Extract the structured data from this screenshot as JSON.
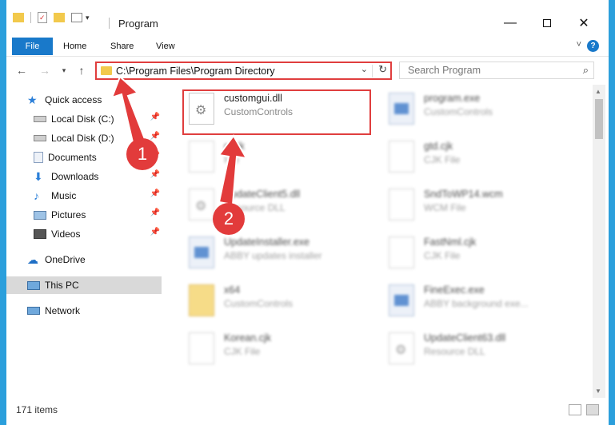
{
  "window": {
    "title": "Program",
    "minimize_icon": "minimize-icon",
    "maximize_icon": "maximize-icon",
    "close_icon": "close-icon"
  },
  "ribbon": {
    "tabs": [
      "File",
      "Home",
      "Share",
      "View"
    ],
    "help": "?"
  },
  "address": {
    "path": "C:\\Program Files\\Program Directory"
  },
  "search": {
    "placeholder": "Search Program"
  },
  "nav": {
    "items": [
      {
        "label": "Quick access",
        "icon": "star-icon"
      },
      {
        "label": "Local Disk (C:)",
        "icon": "drive-icon"
      },
      {
        "label": "Local Disk (D:)",
        "icon": "drive-icon"
      },
      {
        "label": "Documents",
        "icon": "documents-icon"
      },
      {
        "label": "Downloads",
        "icon": "download-icon"
      },
      {
        "label": "Music",
        "icon": "music-icon"
      },
      {
        "label": "Pictures",
        "icon": "pictures-icon"
      },
      {
        "label": "Videos",
        "icon": "videos-icon"
      },
      {
        "label": "OneDrive",
        "icon": "cloud-icon"
      },
      {
        "label": "This PC",
        "icon": "computer-icon"
      },
      {
        "label": "Network",
        "icon": "network-icon"
      }
    ]
  },
  "files": [
    {
      "name": "customgui.dll",
      "type": "CustomControls"
    },
    {
      "name": "program.exe",
      "type": "CustomControls"
    },
    {
      "name": "g.cjk",
      "type": "File"
    },
    {
      "name": "gtd.cjk",
      "type": "CJK File"
    },
    {
      "name": "UpdateClient5.dll",
      "type": "Resource DLL"
    },
    {
      "name": "SndToWP14.wcm",
      "type": "WCM File"
    },
    {
      "name": "UpdateInstaller.exe",
      "type": "ABBY updates installer"
    },
    {
      "name": "FastNml.cjk",
      "type": "CJK File"
    },
    {
      "name": "x64",
      "type": "CustomControls"
    },
    {
      "name": "FineExec.exe",
      "type": "ABBY background exe..."
    },
    {
      "name": "Korean.cjk",
      "type": "CJK File"
    },
    {
      "name": "UpdateClient63.dll",
      "type": "Resource DLL"
    }
  ],
  "status": {
    "count": "171 items"
  },
  "annotations": [
    "1",
    "2"
  ],
  "colors": {
    "accent": "#1979ca",
    "frame": "#2b9fdc",
    "highlight": "#e03e3e"
  }
}
